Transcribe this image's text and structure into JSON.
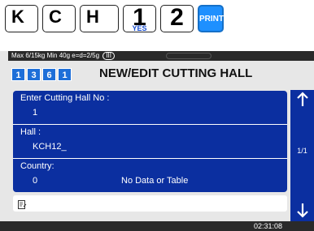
{
  "keys": [
    {
      "label": "K"
    },
    {
      "label": "C"
    },
    {
      "label": "H"
    },
    {
      "label": "1",
      "sub": "YES"
    },
    {
      "label": "2"
    },
    {
      "label": "PRINT"
    }
  ],
  "status": {
    "text": "Max 6/15kg Min 40g e=d=2/5g",
    "badge": "III"
  },
  "header": {
    "digits": [
      "1",
      "3",
      "6",
      "1"
    ],
    "title": "NEW/EDIT CUTTING HALL"
  },
  "form": {
    "cutting_hall_no": {
      "label": "Enter Cutting Hall No :",
      "value": "1"
    },
    "hall": {
      "label": "Hall :",
      "value": "KCH12_"
    },
    "country": {
      "label": "Country:",
      "value": "0",
      "note": "No Data or Table"
    }
  },
  "pager": {
    "text": "1/1"
  },
  "clock": "02:31:08",
  "colors": {
    "panel": "#0b2fa0",
    "digit": "#1e6fd8",
    "print_key": "#1e90ff"
  }
}
